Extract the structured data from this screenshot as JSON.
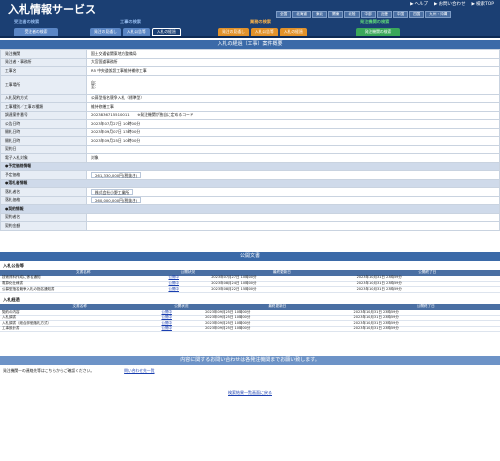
{
  "header": {
    "title": "入札情報サービス",
    "links": [
      "ヘルプ",
      "お問い合わせ",
      "検索TOP"
    ],
    "prefectures": [
      "全国",
      "北海道",
      "東北",
      "関東",
      "北陸",
      "中部",
      "近畿",
      "中国",
      "四国",
      "九州・沖縄"
    ],
    "groups": [
      "受注者の検索",
      "工事の検索",
      "業務の検索",
      "発注機関の検索"
    ],
    "nav": [
      "受注者の検索",
      "発注の見通し",
      "入札公告等",
      "入札の経過",
      "発注の見通し",
      "入札公告等",
      "入札の経過",
      "発注機関の検索"
    ]
  },
  "page_title": "入札の経過（工事）案件概要",
  "summary": [
    {
      "k": "発注機関",
      "v": "国土交通省関東地方整備局"
    },
    {
      "k": "発注者・事務所",
      "v": "大宮国道事務所"
    },
    {
      "k": "工事名",
      "v": "R5 中央道仮設工事維持補修工事"
    },
    {
      "k": "工事場所",
      "v": "自：\n至："
    },
    {
      "k": "入札契約方式",
      "v": "公募型指名競争入札（標準型）"
    },
    {
      "k": "工事種別／工事の種類",
      "v": "維持修繕工事"
    },
    {
      "k": "調達案件番号",
      "v": "2023836715510011　　※発注機関が独自に定めるコード"
    },
    {
      "k": "公告日時",
      "v": "2023年07月27日 10時00分"
    },
    {
      "k": "開札日時",
      "v": "2023年09月07日 13時00分"
    },
    {
      "k": "開札日時",
      "v": "2023年09月25日 10時00分"
    },
    {
      "k": "契約日",
      "v": ""
    },
    {
      "k": "電子入札対象",
      "v": "対象"
    }
  ],
  "price_section": "●予定価格情報",
  "price": {
    "k": "予定価格",
    "v": "261,330,000円(税抜き)"
  },
  "award_section": "●落札者情報",
  "award": [
    {
      "k": "落札者名",
      "v": "株式会社小野工業所"
    },
    {
      "k": "落札価格",
      "v": "260,000,000円(税抜き)"
    }
  ],
  "contract_section": "●契約情報",
  "contract": [
    {
      "k": "契約者名",
      "v": ""
    },
    {
      "k": "契約金額",
      "v": ""
    }
  ],
  "docs_title": "公開文書",
  "notice_caption": "入札公告等",
  "cols": [
    "文書名称",
    "公開状況",
    "最終更新日",
    "公開終了日"
  ],
  "notice_rows": [
    [
      "技術資料作成に係る通知",
      "公開中",
      "2023年07月27日 10時00分",
      "2023年10月31日 23時59分"
    ],
    [
      "電算化仕様書",
      "公開中",
      "2023年08月24日 10時00分",
      "2023年10月31日 23時59分"
    ],
    [
      "公募型指名競争入札の指名通知書",
      "公開中",
      "2023年08月22日 15時00分",
      "2023年10月31日 23時59分"
    ]
  ],
  "process_caption": "入札経過",
  "process_rows": [
    [
      "契約の内容",
      "公開中",
      "2023年09月25日 10時00分",
      "2023年10月31日 23時59分"
    ],
    [
      "入札調書",
      "公開中",
      "2023年09月25日 10時00分",
      "2023年10月31日 23時59分"
    ],
    [
      "入札調書（総合評価落札方式）",
      "公開中",
      "2023年09月25日 10時00分",
      "2023年10月31日 23時59分"
    ],
    [
      "工事設計書",
      "公開中",
      "2023年09月25日 10時00分",
      "2023年10月31日 23時59分"
    ]
  ],
  "footer_band": "内容に関するお問い合わせは各発注機関までお願い致します。",
  "footer_text": "発注機関一の連絡先等はこちらからご確認ください。",
  "footer_link": "問い合わせ先一覧",
  "back_link": "検索結果一覧画面に戻る"
}
